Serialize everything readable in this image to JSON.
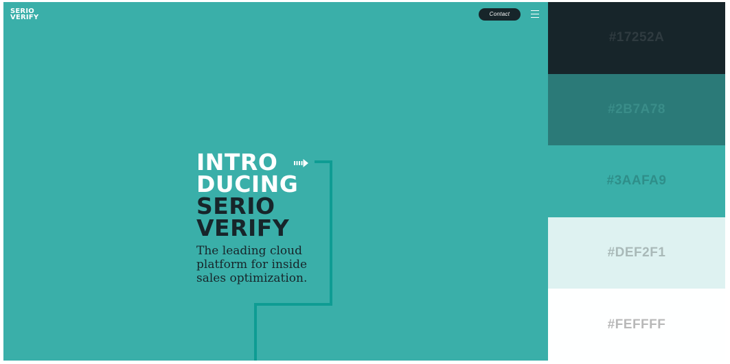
{
  "logo": {
    "line1": "SERIO",
    "line2": "VERIFY"
  },
  "header": {
    "contact_label": "Contact",
    "menu_icon": "hamburger-menu-icon"
  },
  "hero": {
    "line1": "INTRO",
    "line2": "DUCING",
    "line3": "SERIO",
    "line4": "VERIFY",
    "tagline": [
      "The leading cloud",
      "platform for inside",
      "sales optimization."
    ],
    "arrow_icon": "dashed-arrow-right-icon"
  },
  "palette": [
    {
      "hex": "#17252A",
      "label": "#17252A",
      "text_color": "#2f3b40"
    },
    {
      "hex": "#2B7A78",
      "label": "#2B7A78",
      "text_color": "#3a8d89"
    },
    {
      "hex": "#3AAFA9",
      "label": "#3AAFA9",
      "text_color": "#2e8e89"
    },
    {
      "hex": "#DEF2F1",
      "label": "#DEF2F1",
      "text_color": "#a9b9b8"
    },
    {
      "hex": "#FEFFFF",
      "label": "#FEFFFF",
      "text_color": "#b8b8b8"
    }
  ]
}
